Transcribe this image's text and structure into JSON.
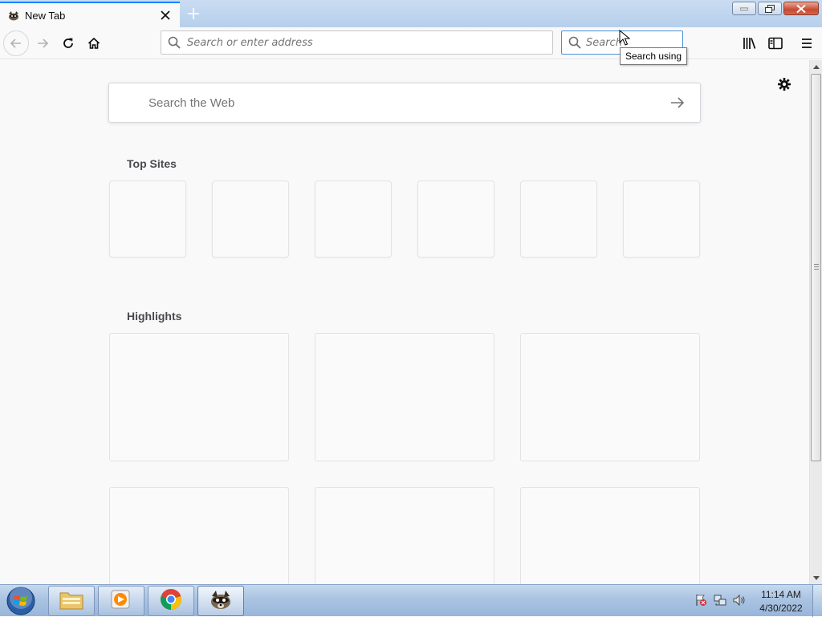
{
  "browser": {
    "tab": {
      "title": "New Tab",
      "favicon": "browser-mascot-icon"
    },
    "new_tab_icon": "plus-icon",
    "window_controls": [
      "minimize-icon",
      "restore-icon",
      "close-icon"
    ]
  },
  "toolbar": {
    "urlbar_placeholder": "Search or enter address",
    "searchbar_placeholder": "Search",
    "tooltip": "Search using",
    "icons": [
      "back-icon",
      "forward-icon",
      "reload-icon",
      "home-icon",
      "library-icon",
      "sidebar-icon",
      "menu-icon"
    ]
  },
  "newtab": {
    "search_placeholder": "Search the Web",
    "top_sites_title": "Top Sites",
    "highlights_title": "Highlights",
    "top_sites_count": 6,
    "highlights_count": 6
  },
  "taskbar": {
    "apps": [
      "windows-explorer",
      "media-player",
      "chrome",
      "browser"
    ],
    "active_app": "browser",
    "time": "11:14 AM",
    "date": "4/30/2022"
  },
  "colors": {
    "accent": "#0a84ff",
    "page_background": "#f9f9fa",
    "taskbar": "#aac3e2"
  }
}
